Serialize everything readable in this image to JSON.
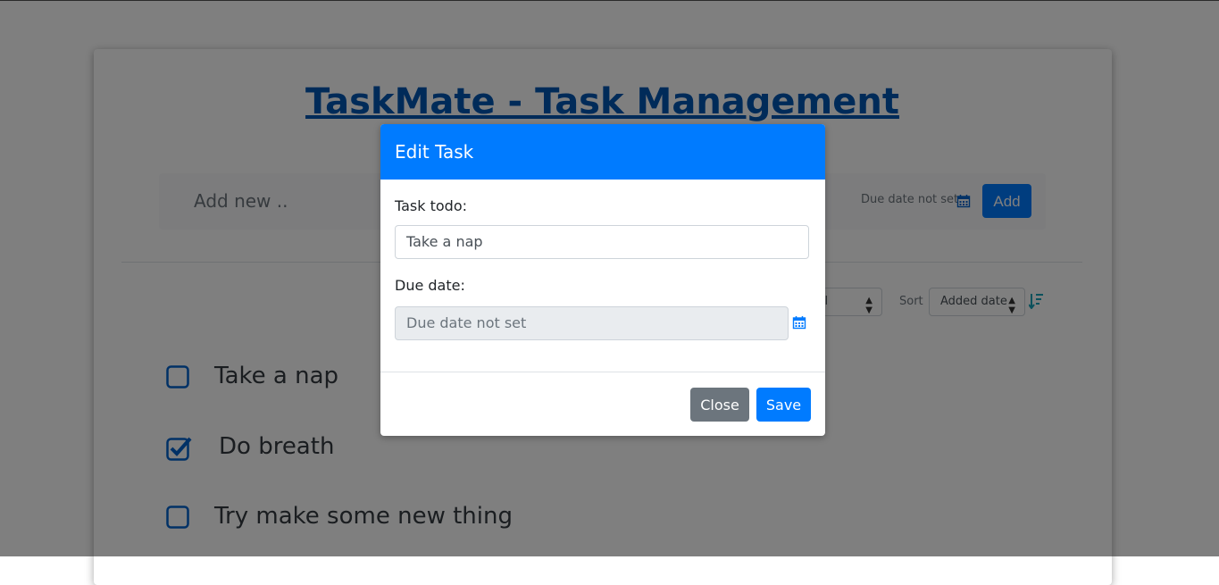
{
  "app": {
    "title": "TaskMate - Task Management"
  },
  "add_bar": {
    "placeholder": "Add new ..",
    "due_text": "Due date not set",
    "add_label": "Add"
  },
  "toolbar": {
    "filter_value": "All",
    "sort_label": "Sort",
    "sort_value": "Added date"
  },
  "tasks": [
    {
      "label": "Take a nap",
      "done": false
    },
    {
      "label": "Do breath",
      "done": true
    },
    {
      "label": "Try make some new thing",
      "done": false
    }
  ],
  "modal": {
    "title": "Edit Task",
    "task_label": "Task todo:",
    "task_value": "Take a nap",
    "due_label": "Due date:",
    "due_placeholder": "Due date not set",
    "close_label": "Close",
    "save_label": "Save"
  },
  "colors": {
    "primary": "#007bff",
    "secondary": "#6c757d",
    "overlay": "rgba(0,0,0,0.5)"
  },
  "icons": [
    "calendar-icon",
    "sort-descending-icon",
    "checkbox-icon",
    "checkbox-checked-icon"
  ]
}
